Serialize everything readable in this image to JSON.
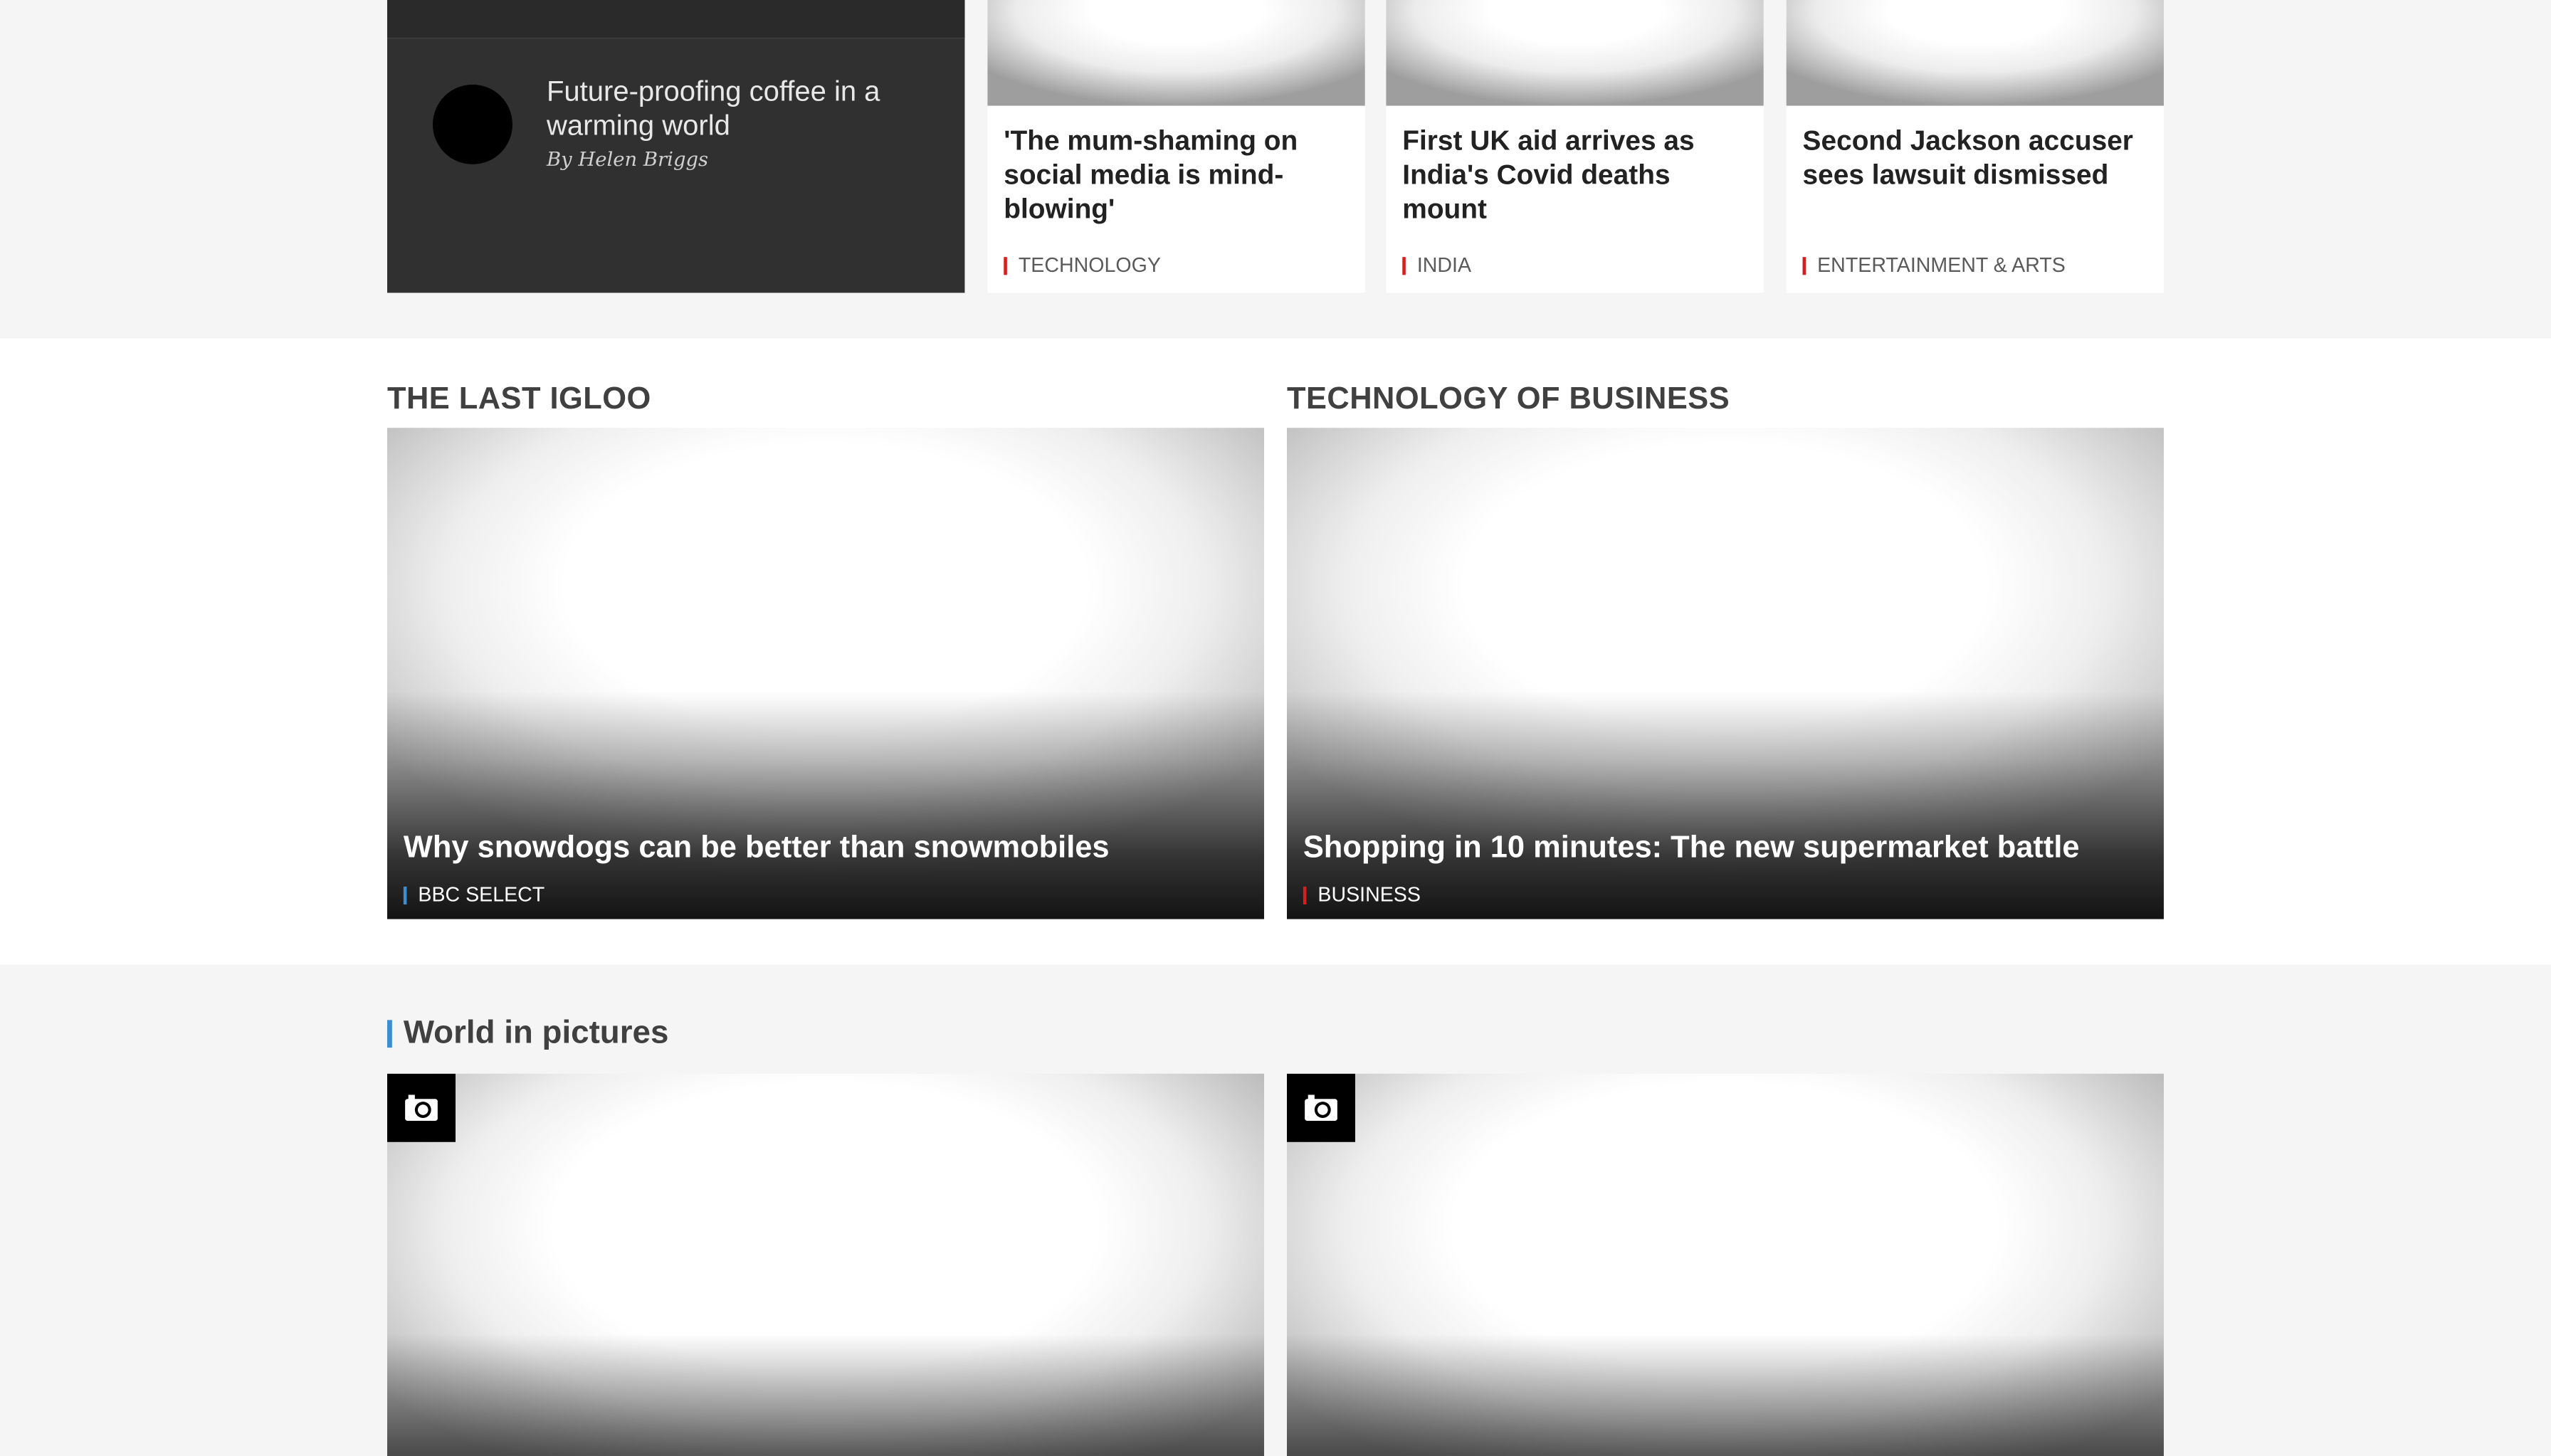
{
  "top_stories": {
    "featured": {
      "headline": "Future-proofing coffee in a warming world",
      "byline": "By Helen Briggs"
    },
    "cards": [
      {
        "title": "'The mum-shaming on social media is mind-blowing'",
        "tag": "TECHNOLOGY"
      },
      {
        "title": "First UK aid arrives as India's Covid deaths mount",
        "tag": "INDIA"
      },
      {
        "title": "Second Jackson accuser sees lawsuit dismissed",
        "tag": "ENTERTAINMENT & ARTS"
      }
    ]
  },
  "features": [
    {
      "section": "THE LAST IGLOO",
      "title": "Why snowdogs can be better than snowmobiles",
      "tag": "BBC SELECT",
      "tag_color": "#3d8ed0"
    },
    {
      "section": "TECHNOLOGY OF BUSINESS",
      "title": "Shopping in 10 minutes: The new supermarket battle",
      "tag": "BUSINESS",
      "tag_color": "#d31f1f"
    }
  ],
  "world_in_pictures": {
    "title": "World in pictures",
    "photos": [
      {
        "icon": "camera-icon"
      },
      {
        "icon": "camera-icon"
      }
    ]
  },
  "colors": {
    "accent_red": "#d31f1f",
    "accent_blue": "#3d8ed0",
    "dark_card": "#303030",
    "page_bg": "#f5f5f5"
  }
}
